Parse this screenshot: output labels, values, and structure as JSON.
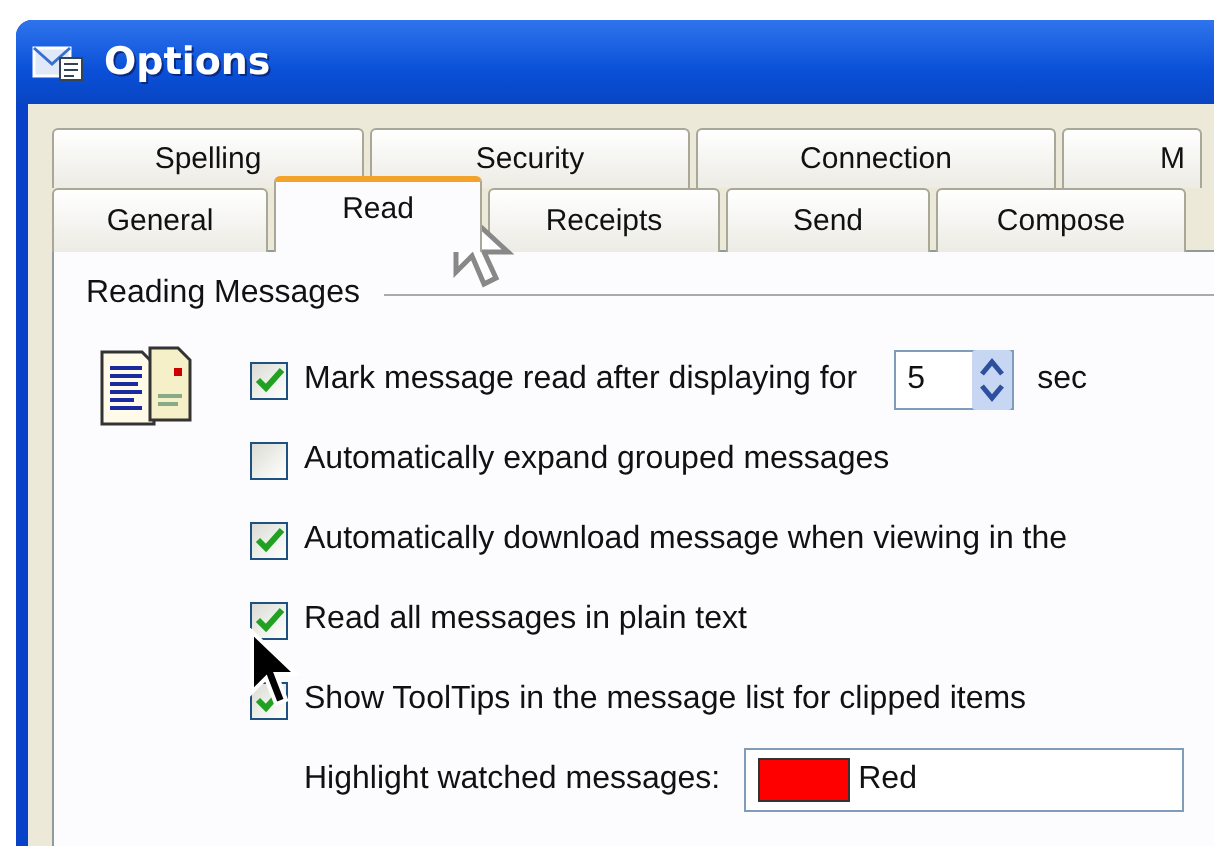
{
  "window": {
    "title": "Options"
  },
  "tabs_back_row": [
    {
      "label": "Spelling",
      "selected": false
    },
    {
      "label": "Security",
      "selected": false
    },
    {
      "label": "Connection",
      "selected": false
    },
    {
      "label": "M",
      "selected": false
    }
  ],
  "tabs_front_row": [
    {
      "label": "General",
      "selected": false
    },
    {
      "label": "Read",
      "selected": true
    },
    {
      "label": "Receipts",
      "selected": false
    },
    {
      "label": "Send",
      "selected": false
    },
    {
      "label": "Compose",
      "selected": false
    }
  ],
  "group": {
    "title": "Reading Messages"
  },
  "options": [
    {
      "label": "Mark message read after displaying for",
      "checked": true,
      "spin": {
        "value": "5"
      },
      "suffix": "sec"
    },
    {
      "label": "Automatically expand grouped messages",
      "checked": false
    },
    {
      "label": "Automatically download message when viewing in the",
      "checked": true
    },
    {
      "label": "Read all messages in plain text",
      "checked": true
    },
    {
      "label": "Show ToolTips in the message list for clipped items",
      "checked": true
    }
  ],
  "highlight": {
    "label": "Highlight watched messages:",
    "color": "#ff0000",
    "value": "Red"
  }
}
